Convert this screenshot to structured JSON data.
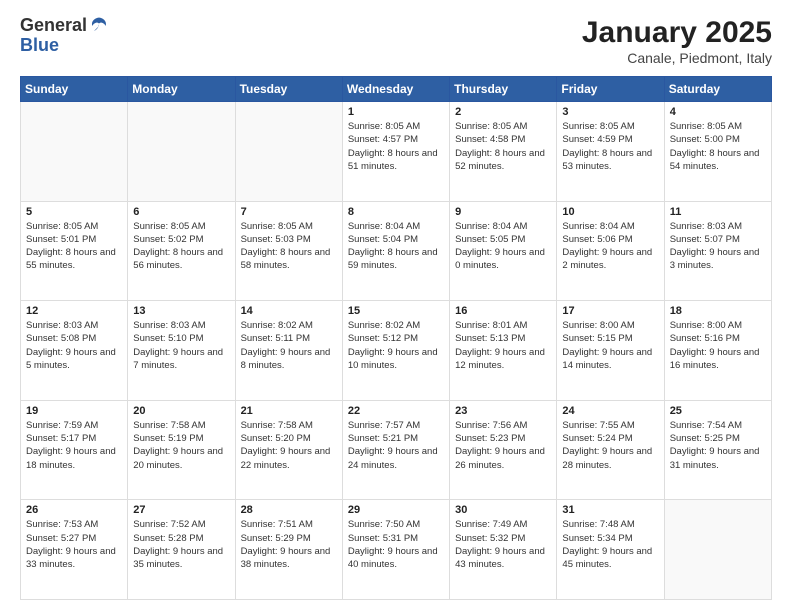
{
  "header": {
    "logo_line1": "General",
    "logo_line2": "Blue",
    "title": "January 2025",
    "subtitle": "Canale, Piedmont, Italy"
  },
  "weekdays": [
    "Sunday",
    "Monday",
    "Tuesday",
    "Wednesday",
    "Thursday",
    "Friday",
    "Saturday"
  ],
  "weeks": [
    [
      {
        "day": "",
        "info": ""
      },
      {
        "day": "",
        "info": ""
      },
      {
        "day": "",
        "info": ""
      },
      {
        "day": "1",
        "info": "Sunrise: 8:05 AM\nSunset: 4:57 PM\nDaylight: 8 hours and 51 minutes."
      },
      {
        "day": "2",
        "info": "Sunrise: 8:05 AM\nSunset: 4:58 PM\nDaylight: 8 hours and 52 minutes."
      },
      {
        "day": "3",
        "info": "Sunrise: 8:05 AM\nSunset: 4:59 PM\nDaylight: 8 hours and 53 minutes."
      },
      {
        "day": "4",
        "info": "Sunrise: 8:05 AM\nSunset: 5:00 PM\nDaylight: 8 hours and 54 minutes."
      }
    ],
    [
      {
        "day": "5",
        "info": "Sunrise: 8:05 AM\nSunset: 5:01 PM\nDaylight: 8 hours and 55 minutes."
      },
      {
        "day": "6",
        "info": "Sunrise: 8:05 AM\nSunset: 5:02 PM\nDaylight: 8 hours and 56 minutes."
      },
      {
        "day": "7",
        "info": "Sunrise: 8:05 AM\nSunset: 5:03 PM\nDaylight: 8 hours and 58 minutes."
      },
      {
        "day": "8",
        "info": "Sunrise: 8:04 AM\nSunset: 5:04 PM\nDaylight: 8 hours and 59 minutes."
      },
      {
        "day": "9",
        "info": "Sunrise: 8:04 AM\nSunset: 5:05 PM\nDaylight: 9 hours and 0 minutes."
      },
      {
        "day": "10",
        "info": "Sunrise: 8:04 AM\nSunset: 5:06 PM\nDaylight: 9 hours and 2 minutes."
      },
      {
        "day": "11",
        "info": "Sunrise: 8:03 AM\nSunset: 5:07 PM\nDaylight: 9 hours and 3 minutes."
      }
    ],
    [
      {
        "day": "12",
        "info": "Sunrise: 8:03 AM\nSunset: 5:08 PM\nDaylight: 9 hours and 5 minutes."
      },
      {
        "day": "13",
        "info": "Sunrise: 8:03 AM\nSunset: 5:10 PM\nDaylight: 9 hours and 7 minutes."
      },
      {
        "day": "14",
        "info": "Sunrise: 8:02 AM\nSunset: 5:11 PM\nDaylight: 9 hours and 8 minutes."
      },
      {
        "day": "15",
        "info": "Sunrise: 8:02 AM\nSunset: 5:12 PM\nDaylight: 9 hours and 10 minutes."
      },
      {
        "day": "16",
        "info": "Sunrise: 8:01 AM\nSunset: 5:13 PM\nDaylight: 9 hours and 12 minutes."
      },
      {
        "day": "17",
        "info": "Sunrise: 8:00 AM\nSunset: 5:15 PM\nDaylight: 9 hours and 14 minutes."
      },
      {
        "day": "18",
        "info": "Sunrise: 8:00 AM\nSunset: 5:16 PM\nDaylight: 9 hours and 16 minutes."
      }
    ],
    [
      {
        "day": "19",
        "info": "Sunrise: 7:59 AM\nSunset: 5:17 PM\nDaylight: 9 hours and 18 minutes."
      },
      {
        "day": "20",
        "info": "Sunrise: 7:58 AM\nSunset: 5:19 PM\nDaylight: 9 hours and 20 minutes."
      },
      {
        "day": "21",
        "info": "Sunrise: 7:58 AM\nSunset: 5:20 PM\nDaylight: 9 hours and 22 minutes."
      },
      {
        "day": "22",
        "info": "Sunrise: 7:57 AM\nSunset: 5:21 PM\nDaylight: 9 hours and 24 minutes."
      },
      {
        "day": "23",
        "info": "Sunrise: 7:56 AM\nSunset: 5:23 PM\nDaylight: 9 hours and 26 minutes."
      },
      {
        "day": "24",
        "info": "Sunrise: 7:55 AM\nSunset: 5:24 PM\nDaylight: 9 hours and 28 minutes."
      },
      {
        "day": "25",
        "info": "Sunrise: 7:54 AM\nSunset: 5:25 PM\nDaylight: 9 hours and 31 minutes."
      }
    ],
    [
      {
        "day": "26",
        "info": "Sunrise: 7:53 AM\nSunset: 5:27 PM\nDaylight: 9 hours and 33 minutes."
      },
      {
        "day": "27",
        "info": "Sunrise: 7:52 AM\nSunset: 5:28 PM\nDaylight: 9 hours and 35 minutes."
      },
      {
        "day": "28",
        "info": "Sunrise: 7:51 AM\nSunset: 5:29 PM\nDaylight: 9 hours and 38 minutes."
      },
      {
        "day": "29",
        "info": "Sunrise: 7:50 AM\nSunset: 5:31 PM\nDaylight: 9 hours and 40 minutes."
      },
      {
        "day": "30",
        "info": "Sunrise: 7:49 AM\nSunset: 5:32 PM\nDaylight: 9 hours and 43 minutes."
      },
      {
        "day": "31",
        "info": "Sunrise: 7:48 AM\nSunset: 5:34 PM\nDaylight: 9 hours and 45 minutes."
      },
      {
        "day": "",
        "info": ""
      }
    ]
  ]
}
